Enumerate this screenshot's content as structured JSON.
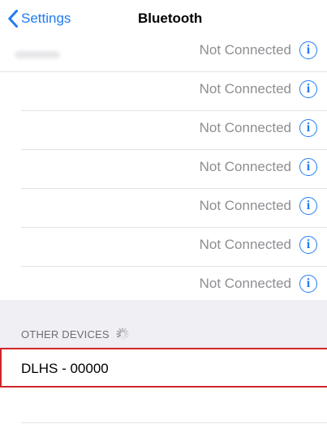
{
  "nav": {
    "back_label": "Settings",
    "title": "Bluetooth"
  },
  "devices": [
    {
      "status": "Not Connected"
    },
    {
      "status": "Not Connected"
    },
    {
      "status": "Not Connected"
    },
    {
      "status": "Not Connected"
    },
    {
      "status": "Not Connected"
    },
    {
      "status": "Not Connected"
    },
    {
      "status": "Not Connected"
    }
  ],
  "info_glyph": "i",
  "other_devices": {
    "header": "OTHER DEVICES",
    "items": [
      {
        "name": "DLHS - 00000"
      }
    ]
  },
  "colors": {
    "accent": "#1f7cf2",
    "highlight": "#cf2727"
  }
}
